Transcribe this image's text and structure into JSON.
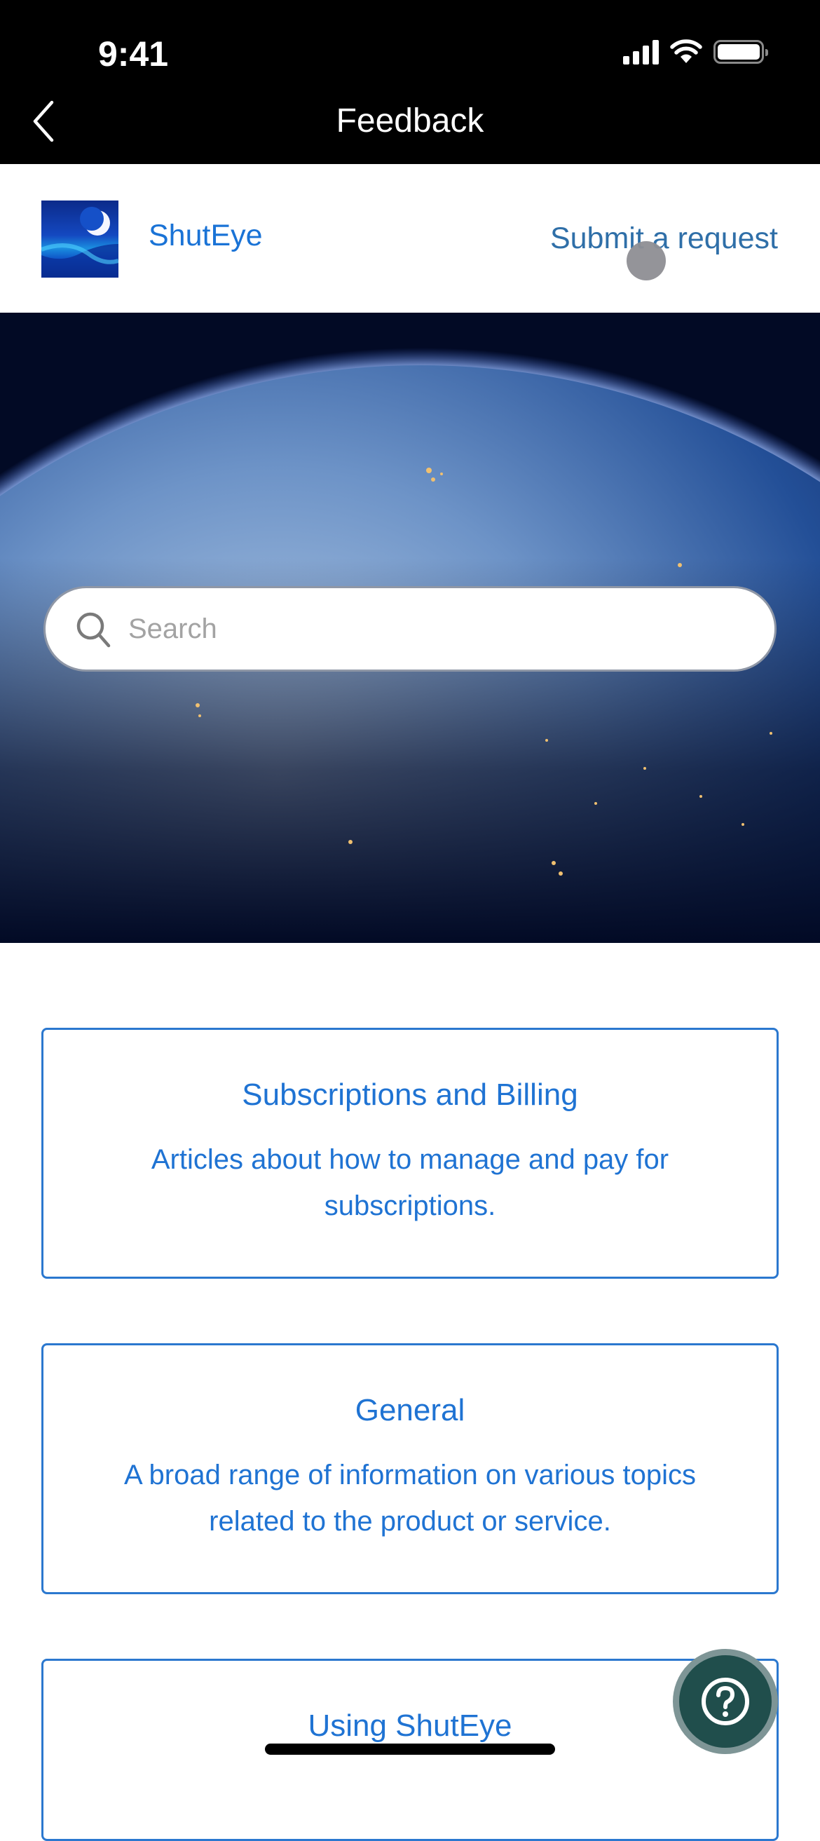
{
  "status_bar": {
    "time": "9:41"
  },
  "nav": {
    "title": "Feedback",
    "back_label": "Back"
  },
  "brand": {
    "name": "ShutEye",
    "submit_request": "Submit a request"
  },
  "search": {
    "placeholder": "Search",
    "value": ""
  },
  "categories": [
    {
      "title": "Subscriptions and Billing",
      "description": "Articles about how to manage and pay for subscriptions."
    },
    {
      "title": "General",
      "description": "A broad range of information on various topics related to the product or service."
    },
    {
      "title": "Using ShutEye",
      "description": ""
    }
  ],
  "help_button": {
    "icon": "question-circle-icon"
  },
  "colors": {
    "accent": "#1f73d3",
    "submit_link": "#2f6fa8",
    "card_border": "#2b78cf",
    "help_fab": "#204e4c",
    "hero_background": "#020a25"
  }
}
